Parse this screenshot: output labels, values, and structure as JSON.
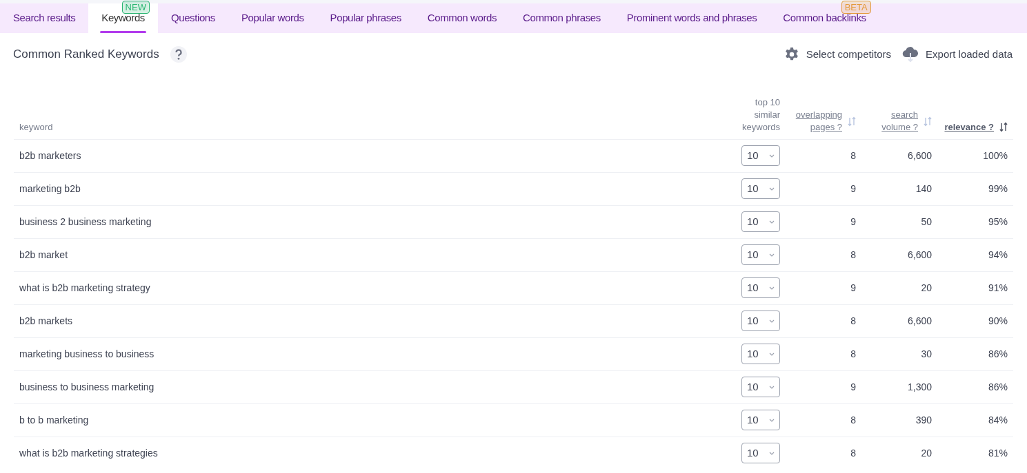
{
  "tabs": [
    {
      "label": "Search results",
      "selected": false
    },
    {
      "label": "Keywords",
      "selected": true,
      "badge": {
        "text": "NEW",
        "color": "#2bb673"
      }
    },
    {
      "label": "Questions",
      "selected": false
    },
    {
      "label": "Popular words",
      "selected": false
    },
    {
      "label": "Popular phrases",
      "selected": false
    },
    {
      "label": "Common words",
      "selected": false
    },
    {
      "label": "Common phrases",
      "selected": false
    },
    {
      "label": "Prominent words and phrases",
      "selected": false
    },
    {
      "label": "Common backlinks",
      "selected": false,
      "badge": {
        "text": "BETA",
        "color": "#e39a3b"
      }
    }
  ],
  "panel": {
    "title": "Common Ranked Keywords",
    "actions": [
      {
        "kind": "settings",
        "label": "Select competitors"
      },
      {
        "kind": "export",
        "label": "Export loaded data"
      }
    ]
  },
  "table": {
    "columns": [
      {
        "label": "keyword",
        "kind": "plain"
      },
      {
        "label": "top 10 similar keywords",
        "kind": "plain"
      },
      {
        "label": "overlapping pages ?",
        "kind": "sortable",
        "selected": false
      },
      {
        "label": "search volume ?",
        "kind": "sortable",
        "selected": false
      },
      {
        "label": "relevance ?",
        "kind": "sortable",
        "selected": true
      }
    ],
    "rows": [
      [
        "b2b marketers",
        "10",
        "8",
        "6,600",
        "100%"
      ],
      [
        "marketing b2b",
        "10",
        "9",
        "140",
        "99%"
      ],
      [
        "business 2 business marketing",
        "10",
        "9",
        "50",
        "95%"
      ],
      [
        "b2b market",
        "10",
        "8",
        "6,600",
        "94%"
      ],
      [
        "what is b2b marketing strategy",
        "10",
        "9",
        "20",
        "91%"
      ],
      [
        "b2b markets",
        "10",
        "8",
        "6,600",
        "90%"
      ],
      [
        "marketing business to business",
        "10",
        "8",
        "30",
        "86%"
      ],
      [
        "business to business marketing",
        "10",
        "9",
        "1,300",
        "86%"
      ],
      [
        "b to b marketing",
        "10",
        "8",
        "390",
        "84%"
      ],
      [
        "what is b2b marketing strategies",
        "10",
        "8",
        "20",
        "81%"
      ]
    ]
  }
}
